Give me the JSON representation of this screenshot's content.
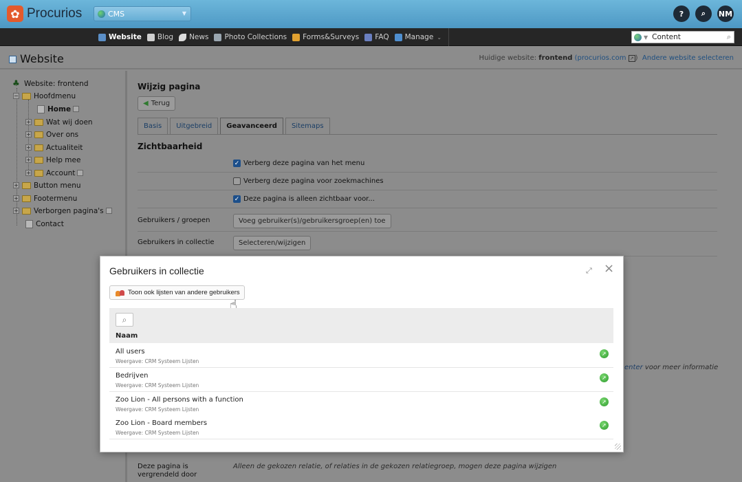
{
  "topbar": {
    "brand": "Procurios",
    "module_select": "CMS",
    "help_label": "?",
    "search_label": "⌕",
    "user_initials": "NM"
  },
  "nav": {
    "items": [
      {
        "label": "Website",
        "color": "#5b8fc7",
        "active": true
      },
      {
        "label": "Blog",
        "color": "#cfcfcf",
        "active": false
      },
      {
        "label": "News",
        "color": "#dcdcdc",
        "active": false
      },
      {
        "label": "Photo Collections",
        "color": "#9aa6b0",
        "active": false
      },
      {
        "label": "Forms&Surveys",
        "color": "#e0a030",
        "active": false
      },
      {
        "label": "FAQ",
        "color": "#6a7fc0",
        "active": false
      },
      {
        "label": "Manage",
        "color": "#4f8fd0",
        "active": false
      }
    ],
    "content_search": "Content"
  },
  "header": {
    "title": "Website",
    "current_site_label": "Huidige website:",
    "current_site_name": "frontend",
    "current_site_domain": "(procurios.com",
    "current_site_close": ")",
    "change_site": "Andere website selecteren"
  },
  "tree": {
    "root": "Website: frontend",
    "items": [
      {
        "label": "Hoofdmenu"
      },
      {
        "label": "Home"
      },
      {
        "label": "Wat wij doen"
      },
      {
        "label": "Over ons"
      },
      {
        "label": "Actualiteit"
      },
      {
        "label": "Help mee"
      },
      {
        "label": "Account"
      },
      {
        "label": "Button menu"
      },
      {
        "label": "Footermenu"
      },
      {
        "label": "Verborgen pagina's"
      },
      {
        "label": "Contact"
      }
    ]
  },
  "main": {
    "title": "Wijzig pagina",
    "back_button": "Terug",
    "tabs": [
      "Basis",
      "Uitgebreid",
      "Geavanceerd",
      "Sitemaps"
    ],
    "section": "Zichtbaarheid",
    "checkboxes": [
      {
        "label": "Verberg deze pagina van het menu",
        "checked": true
      },
      {
        "label": "Verberg deze pagina voor zoekmachines",
        "checked": false
      },
      {
        "label": "Deze pagina is alleen zichtbaar voor...",
        "checked": true
      }
    ],
    "users_groups_label": "Gebruikers / groepen",
    "users_groups_button": "Voeg gebruiker(s)/gebruikersgroep(en) toe",
    "collection_label": "Gebruikers in collectie",
    "collection_button": "Selecteren/wijzigen",
    "hint_link": "enter",
    "hint_rest": " voor meer informatie",
    "locked_label": "Deze pagina is vergrendeld door",
    "locked_hint": "Alleen de gekozen relatie, of relaties in de gekozen relatiegroep, mogen deze pagina wijzigen"
  },
  "modal": {
    "title": "Gebruikers in collectie",
    "show_others_button": "Toon ook lijsten van andere gebruikers",
    "column_name": "Naam",
    "rows": [
      {
        "name": "All users",
        "sub": "Weergave: CRM Systeem Lijsten"
      },
      {
        "name": "Bedrijven",
        "sub": "Weergave: CRM Systeem Lijsten"
      },
      {
        "name": "Zoo Lion - All persons with a function",
        "sub": "Weergave: CRM Systeem Lijsten"
      },
      {
        "name": "Zoo Lion - Board members",
        "sub": "Weergave: CRM Systeem Lijsten"
      }
    ]
  }
}
